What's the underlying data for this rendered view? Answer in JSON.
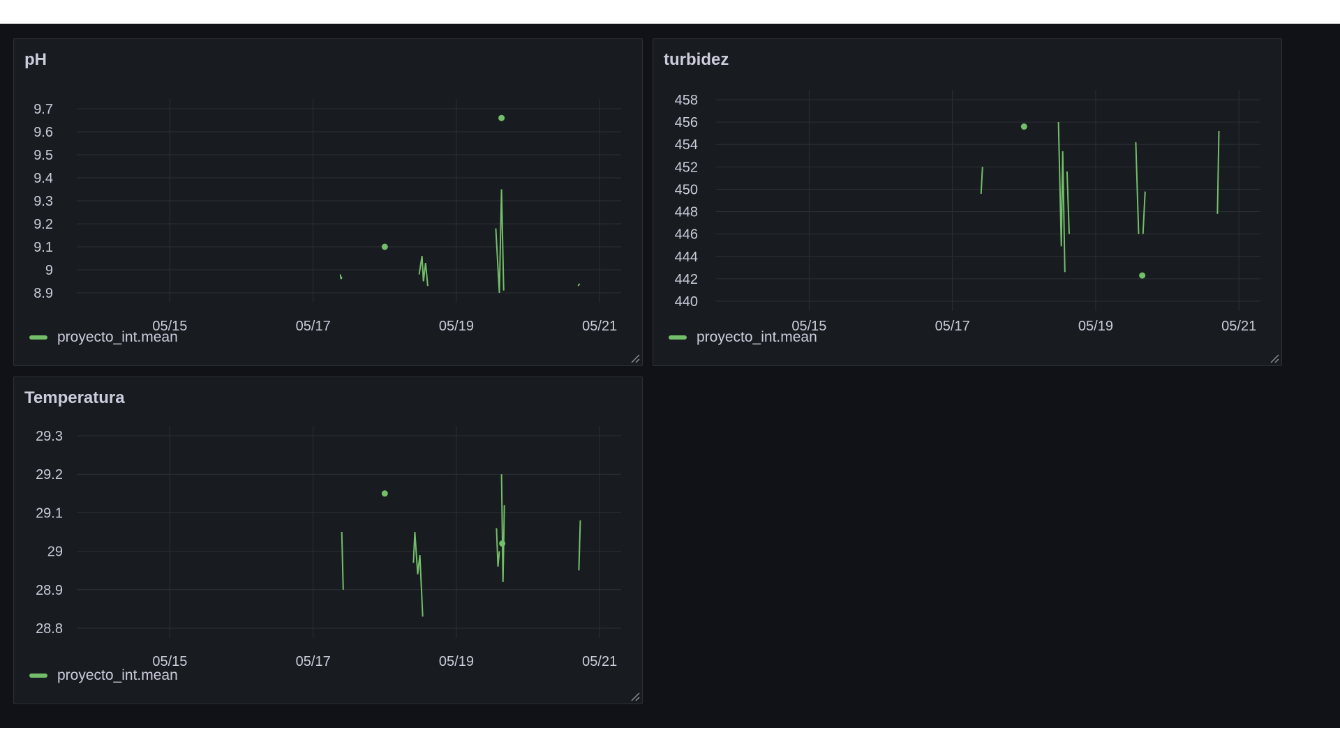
{
  "theme": {
    "panel_bg": "#181b1f",
    "grid": "#2c3037",
    "text": "#ccccdc",
    "series": "#73bf69"
  },
  "panels": [
    {
      "title": "pH",
      "legend": "proyecto_int.mean",
      "chart_data": {
        "type": "line",
        "title": "pH",
        "x_ticks": [
          "05/15",
          "05/17",
          "05/19",
          "05/21"
        ],
        "y_ticks": [
          "8.9",
          "9",
          "9.1",
          "9.2",
          "9.3",
          "9.4",
          "9.5",
          "9.6",
          "9.7"
        ],
        "ylim": [
          8.9,
          9.7
        ],
        "xlim": [
          13.7,
          21.3
        ],
        "grid": true,
        "legend_position": "bottom-left",
        "series": [
          {
            "name": "proyecto_int.mean",
            "color": "#73bf69",
            "segments": [
              [
                [
                  17.38,
                  8.98
                ],
                [
                  17.39,
                  8.96
                ],
                [
                  17.4,
                  8.97
                ]
              ],
              [
                [
                  18.48,
                  8.98
                ],
                [
                  18.52,
                  9.06
                ],
                [
                  18.54,
                  8.95
                ],
                [
                  18.57,
                  9.03
                ],
                [
                  18.6,
                  8.93
                ]
              ],
              [
                [
                  19.55,
                  9.18
                ],
                [
                  19.6,
                  8.9
                ],
                [
                  19.63,
                  9.35
                ],
                [
                  19.66,
                  8.91
                ]
              ],
              [
                [
                  20.7,
                  8.93
                ],
                [
                  20.72,
                  8.94
                ]
              ]
            ],
            "points": [
              [
                18.0,
                9.1
              ],
              [
                19.63,
                9.66
              ]
            ]
          }
        ]
      }
    },
    {
      "title": "turbidez",
      "legend": "proyecto_int.mean",
      "chart_data": {
        "type": "line",
        "title": "turbidez",
        "x_ticks": [
          "05/15",
          "05/17",
          "05/19",
          "05/21"
        ],
        "y_ticks": [
          "440",
          "442",
          "444",
          "446",
          "448",
          "450",
          "452",
          "454",
          "456",
          "458"
        ],
        "ylim": [
          440,
          458
        ],
        "xlim": [
          13.7,
          21.3
        ],
        "grid": true,
        "legend_position": "bottom-left",
        "series": [
          {
            "name": "proyecto_int.mean",
            "color": "#73bf69",
            "segments": [
              [
                [
                  17.4,
                  449.6
                ],
                [
                  17.42,
                  452.0
                ]
              ],
              [
                [
                  18.48,
                  456.0
                ],
                [
                  18.52,
                  444.9
                ],
                [
                  18.54,
                  453.4
                ],
                [
                  18.57,
                  442.6
                ]
              ],
              [
                [
                  18.6,
                  451.6
                ],
                [
                  18.63,
                  446.0
                ]
              ],
              [
                [
                  19.56,
                  454.2
                ],
                [
                  19.6,
                  446.0
                ]
              ],
              [
                [
                  19.66,
                  446.0
                ],
                [
                  19.69,
                  449.8
                ]
              ],
              [
                [
                  20.7,
                  447.8
                ],
                [
                  20.72,
                  455.2
                ]
              ]
            ],
            "points": [
              [
                18.0,
                455.6
              ],
              [
                19.65,
                442.3
              ]
            ]
          }
        ]
      }
    },
    {
      "title": "Temperatura",
      "legend": "proyecto_int.mean",
      "chart_data": {
        "type": "line",
        "title": "Temperatura",
        "x_ticks": [
          "05/15",
          "05/17",
          "05/19",
          "05/21"
        ],
        "y_ticks": [
          "28.8",
          "28.9",
          "29",
          "29.1",
          "29.2",
          "29.3"
        ],
        "ylim": [
          28.8,
          29.3
        ],
        "xlim": [
          13.7,
          21.3
        ],
        "grid": true,
        "legend_position": "bottom-left",
        "series": [
          {
            "name": "proyecto_int.mean",
            "color": "#73bf69",
            "segments": [
              [
                [
                  17.4,
                  29.05
                ],
                [
                  17.42,
                  28.9
                ]
              ],
              [
                [
                  18.4,
                  28.97
                ],
                [
                  18.42,
                  29.05
                ],
                [
                  18.46,
                  28.94
                ],
                [
                  18.49,
                  28.99
                ],
                [
                  18.53,
                  28.83
                ]
              ],
              [
                [
                  19.56,
                  29.06
                ],
                [
                  19.58,
                  28.96
                ],
                [
                  19.6,
                  29.0
                ]
              ],
              [
                [
                  19.63,
                  29.2
                ],
                [
                  19.65,
                  28.92
                ],
                [
                  19.67,
                  29.12
                ]
              ],
              [
                [
                  20.71,
                  28.95
                ],
                [
                  20.73,
                  29.08
                ]
              ]
            ],
            "points": [
              [
                18.0,
                29.15
              ],
              [
                19.64,
                29.02
              ]
            ]
          }
        ]
      }
    }
  ]
}
